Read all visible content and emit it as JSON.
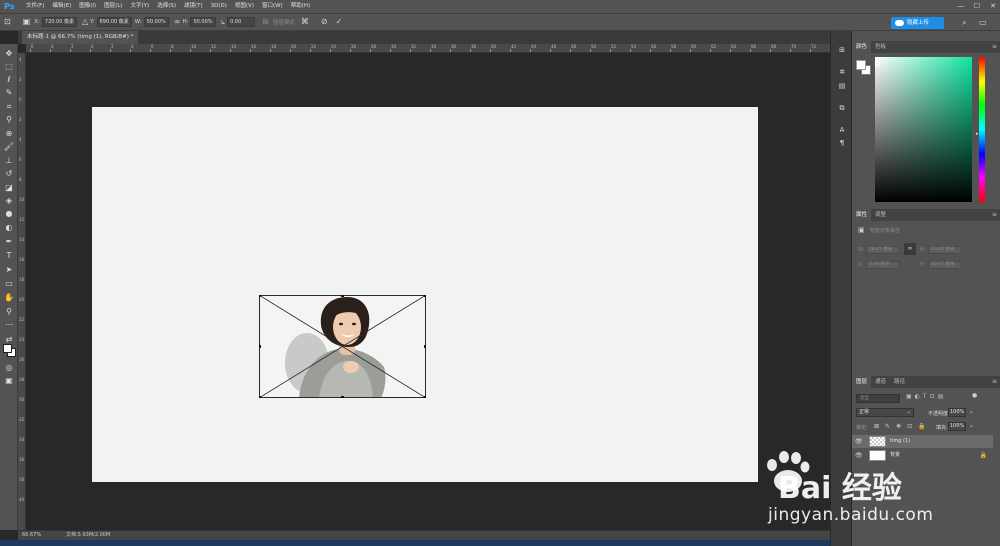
{
  "app": {
    "logo": "Ps"
  },
  "menu": [
    "文件(F)",
    "编辑(E)",
    "图像(I)",
    "图层(L)",
    "文字(Y)",
    "选择(S)",
    "滤镜(T)",
    "3D(D)",
    "视图(V)",
    "窗口(W)",
    "帮助(H)"
  ],
  "window_controls": [
    "—",
    "☐",
    "✕"
  ],
  "options": {
    "x_label": "X:",
    "x_value": "720.00 像素",
    "y_label": "Y:",
    "y_value": "690.00 像素",
    "w_label": "W:",
    "w_value": "50.00%",
    "h_label": "H:",
    "h_value": "50.00%",
    "angle_value": "0.00",
    "interp_label": "插值模式",
    "upload_label": "隐藏上传"
  },
  "document": {
    "tab_title": "未标题-1 @ 66.7% (timg (1), RGB/8#) *",
    "zoom": "66.67%",
    "doc_info": "文档:5.93M/2.00M"
  },
  "ruler_top_labels": [
    "6",
    "4",
    "2",
    "0",
    "2",
    "4",
    "6",
    "8",
    "10",
    "12",
    "14",
    "16",
    "18",
    "20",
    "22",
    "24",
    "26",
    "28",
    "30",
    "32",
    "34",
    "36",
    "38",
    "40",
    "42",
    "44",
    "46",
    "48",
    "50",
    "52",
    "54",
    "56",
    "58",
    "60",
    "62",
    "64",
    "66",
    "68",
    "70",
    "72"
  ],
  "ruler_left_labels": [
    "4",
    "2",
    "0",
    "2",
    "4",
    "6",
    "8",
    "10",
    "12",
    "14",
    "16",
    "18",
    "20",
    "22",
    "24",
    "26",
    "28",
    "30",
    "32",
    "34",
    "36",
    "38",
    "40"
  ],
  "panels": {
    "color_tabs": [
      "颜色",
      "色板"
    ],
    "props_tabs": [
      "属性",
      "调整"
    ],
    "props_title": "智能对象属性",
    "props_w_label": "W:",
    "props_w": "18.47 厘米",
    "props_h_label": "H:",
    "props_h": "10.44 厘米",
    "props_x_label": "X:",
    "props_x": "7.49 厘米",
    "props_y_label": "Y:",
    "props_y": "10.67 厘米",
    "layers_tabs": [
      "图层",
      "通道",
      "路径"
    ],
    "search_placeholder": "类型",
    "blend_mode": "正常",
    "opacity_label": "不透明度:",
    "opacity_value": "100%",
    "lock_label": "锁定:",
    "fill_label": "填充:",
    "fill_value": "100%"
  },
  "layers": [
    {
      "name": "timg (1)",
      "selected": true
    },
    {
      "name": "背景",
      "selected": false
    }
  ],
  "watermark": {
    "logo": "Bai 经验",
    "url": "jingyan.baidu.com"
  },
  "colors": {
    "accent": "#1f8ee6",
    "canvas": "#f1f3f2",
    "panel": "#535353"
  }
}
